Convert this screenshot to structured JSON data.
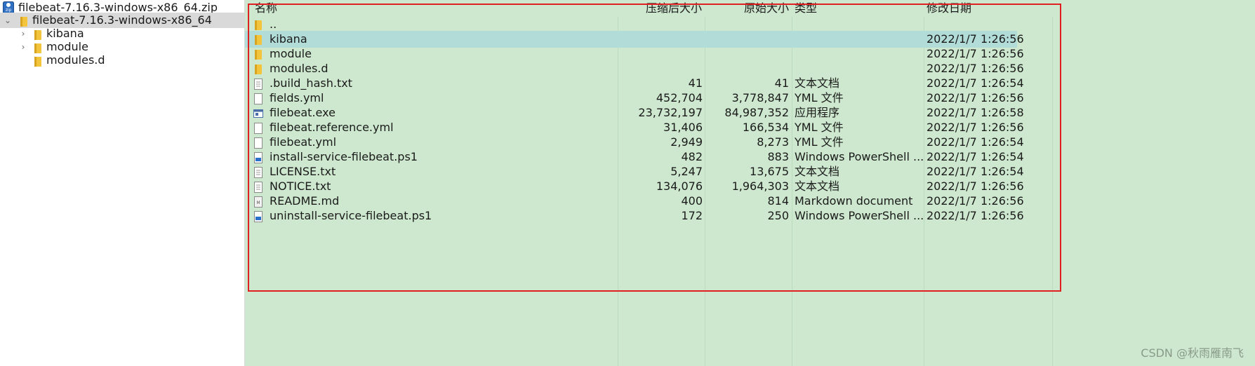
{
  "tree": {
    "zip_name": "filebeat-7.16.3-windows-x86_64.zip",
    "root_folder": "filebeat-7.16.3-windows-x86_64",
    "children": [
      "kibana",
      "module",
      "modules.d"
    ]
  },
  "columns": [
    "名称",
    "压缩后大小",
    "原始大小",
    "类型",
    "修改日期"
  ],
  "files": [
    {
      "name": "..",
      "packed": "",
      "size": "",
      "type": "",
      "modified": "",
      "icon": "folder-icon"
    },
    {
      "name": "kibana",
      "packed": "",
      "size": "",
      "type": "",
      "modified": "2022/1/7 1:26:56",
      "icon": "folder-icon"
    },
    {
      "name": "module",
      "packed": "",
      "size": "",
      "type": "",
      "modified": "2022/1/7 1:26:56",
      "icon": "folder-icon"
    },
    {
      "name": "modules.d",
      "packed": "",
      "size": "",
      "type": "",
      "modified": "2022/1/7 1:26:56",
      "icon": "folder-icon"
    },
    {
      "name": ".build_hash.txt",
      "packed": "41",
      "size": "41",
      "type": "文本文档",
      "modified": "2022/1/7 1:26:54",
      "icon": "text-file-icon"
    },
    {
      "name": "fields.yml",
      "packed": "452,704",
      "size": "3,778,847",
      "type": "YML 文件",
      "modified": "2022/1/7 1:26:56",
      "icon": "file-icon"
    },
    {
      "name": "filebeat.exe",
      "packed": "23,732,197",
      "size": "84,987,352",
      "type": "应用程序",
      "modified": "2022/1/7 1:26:58",
      "icon": "exe-icon"
    },
    {
      "name": "filebeat.reference.yml",
      "packed": "31,406",
      "size": "166,534",
      "type": "YML 文件",
      "modified": "2022/1/7 1:26:56",
      "icon": "file-icon"
    },
    {
      "name": "filebeat.yml",
      "packed": "2,949",
      "size": "8,273",
      "type": "YML 文件",
      "modified": "2022/1/7 1:26:54",
      "icon": "file-icon"
    },
    {
      "name": "install-service-filebeat.ps1",
      "packed": "482",
      "size": "883",
      "type": "Windows PowerShell ...",
      "modified": "2022/1/7 1:26:54",
      "icon": "powershell-icon"
    },
    {
      "name": "LICENSE.txt",
      "packed": "5,247",
      "size": "13,675",
      "type": "文本文档",
      "modified": "2022/1/7 1:26:54",
      "icon": "text-file-icon"
    },
    {
      "name": "NOTICE.txt",
      "packed": "134,076",
      "size": "1,964,303",
      "type": "文本文档",
      "modified": "2022/1/7 1:26:56",
      "icon": "text-file-icon"
    },
    {
      "name": "README.md",
      "packed": "400",
      "size": "814",
      "type": "Markdown document",
      "modified": "2022/1/7 1:26:56",
      "icon": "markdown-icon"
    },
    {
      "name": "uninstall-service-filebeat.ps1",
      "packed": "172",
      "size": "250",
      "type": "Windows PowerShell ...",
      "modified": "2022/1/7 1:26:56",
      "icon": "powershell-icon"
    }
  ],
  "selected_file": "kibana",
  "watermark": "CSDN @秋雨雁南飞",
  "colors": {
    "list_background": "#cde8ce",
    "selected_row": "#b2dcd7",
    "tree_selected": "#d9d9d9",
    "highlight_box": "#e02020",
    "folder": "#f2c53d"
  }
}
